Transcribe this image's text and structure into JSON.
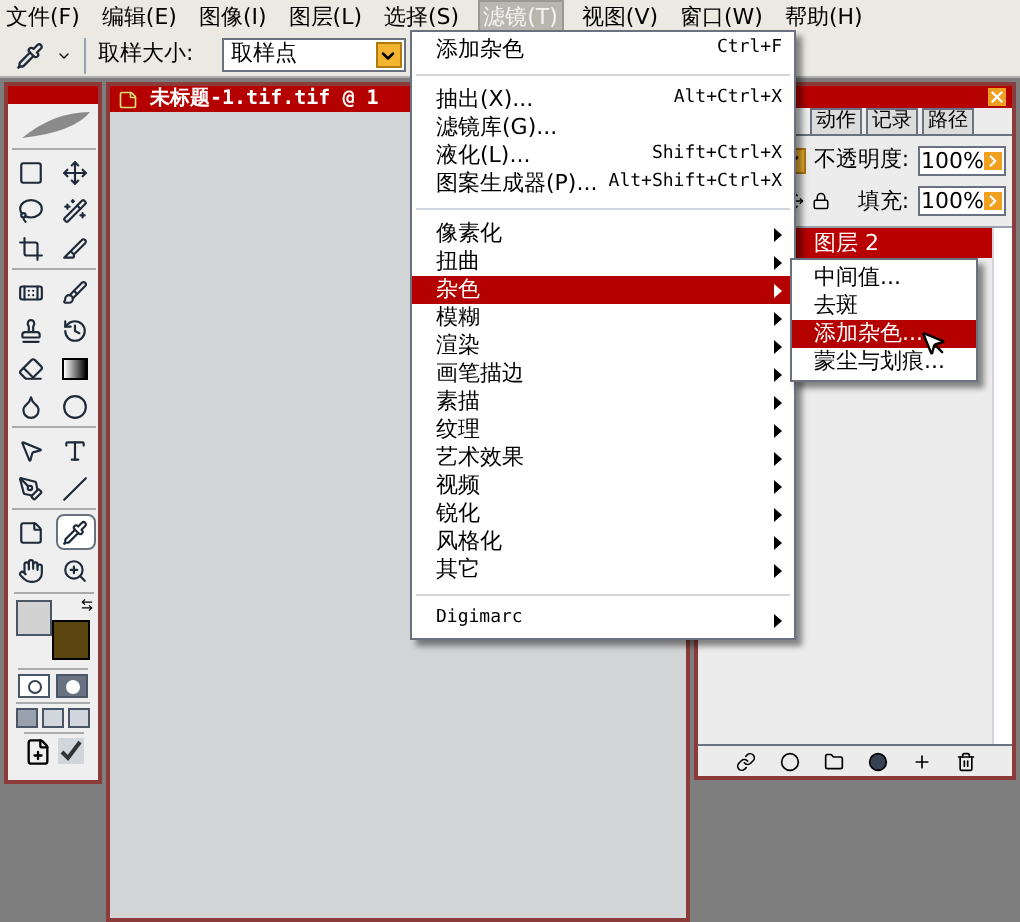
{
  "menu_bar": [
    {
      "label": "文件(F)",
      "selected": false
    },
    {
      "label": "编辑(E)",
      "selected": false
    },
    {
      "label": "图像(I)",
      "selected": false
    },
    {
      "label": "图层(L)",
      "selected": false
    },
    {
      "label": "选择(S)",
      "selected": false
    },
    {
      "label": "滤镜(T)",
      "selected": true
    },
    {
      "label": "视图(V)",
      "selected": false
    },
    {
      "label": "窗口(W)",
      "selected": false
    },
    {
      "label": "帮助(H)",
      "selected": false
    }
  ],
  "options_bar": {
    "sample_size_label": "取样大小:",
    "sample_size_value": "取样点"
  },
  "toolbox": {
    "tools": [
      {
        "kind": "marquee",
        "selected": false
      },
      {
        "kind": "move",
        "selected": false
      },
      {
        "kind": "lasso",
        "selected": false
      },
      {
        "kind": "wand",
        "selected": false
      },
      {
        "kind": "crop",
        "selected": false
      },
      {
        "kind": "slice",
        "selected": false
      },
      {
        "kind": "heal",
        "selected": false
      },
      {
        "kind": "brush",
        "selected": false
      },
      {
        "kind": "stamp",
        "selected": false
      },
      {
        "kind": "history",
        "selected": false
      },
      {
        "kind": "eraser",
        "selected": false
      },
      {
        "kind": "gradient",
        "selected": false
      },
      {
        "kind": "blur",
        "selected": false
      },
      {
        "kind": "burn",
        "selected": false
      },
      {
        "kind": "path",
        "selected": false
      },
      {
        "kind": "type",
        "selected": false
      },
      {
        "kind": "pen",
        "selected": false
      },
      {
        "kind": "line",
        "selected": false
      },
      {
        "kind": "notes",
        "selected": false
      },
      {
        "kind": "eyedropper",
        "selected": true
      },
      {
        "kind": "hand",
        "selected": false
      },
      {
        "kind": "zoom",
        "selected": false
      }
    ],
    "color_swatches": [
      {
        "color": "#d2d2d2"
      },
      {
        "color": "#5a4510"
      }
    ]
  },
  "document": {
    "title": "未标题-1.tif.tif @ 1"
  },
  "filter_menu": [
    {
      "kind": "item",
      "label": "添加杂色",
      "shortcut": "Ctrl+F"
    },
    {
      "kind": "separator"
    },
    {
      "kind": "item",
      "label": "抽出(X)...",
      "shortcut": "Alt+Ctrl+X"
    },
    {
      "kind": "item",
      "label": "滤镜库(G)..."
    },
    {
      "kind": "item",
      "label": "液化(L)...",
      "shortcut": "Shift+Ctrl+X"
    },
    {
      "kind": "item",
      "label": "图案生成器(P)...",
      "shortcut": "Alt+Shift+Ctrl+X"
    },
    {
      "kind": "separator"
    },
    {
      "kind": "submenu",
      "label": "像素化",
      "selected": false
    },
    {
      "kind": "submenu",
      "label": "扭曲",
      "selected": false
    },
    {
      "kind": "submenu",
      "label": "杂色",
      "selected": true
    },
    {
      "kind": "submenu",
      "label": "模糊",
      "selected": false
    },
    {
      "kind": "submenu",
      "label": "渲染",
      "selected": false
    },
    {
      "kind": "submenu",
      "label": "画笔描边",
      "selected": false
    },
    {
      "kind": "submenu",
      "label": "素描",
      "selected": false
    },
    {
      "kind": "submenu",
      "label": "纹理",
      "selected": false
    },
    {
      "kind": "submenu",
      "label": "艺术效果",
      "selected": false
    },
    {
      "kind": "submenu",
      "label": "视频",
      "selected": false
    },
    {
      "kind": "submenu",
      "label": "锐化",
      "selected": false
    },
    {
      "kind": "submenu",
      "label": "风格化",
      "selected": false
    },
    {
      "kind": "submenu",
      "label": "其它",
      "selected": false
    },
    {
      "kind": "separator"
    },
    {
      "kind": "submenu",
      "label": "Digimarc",
      "selected": false
    }
  ],
  "noise_submenu": [
    {
      "label": "中间值...",
      "selected": false
    },
    {
      "label": "去斑",
      "selected": false
    },
    {
      "label": "添加杂色...",
      "selected": true
    },
    {
      "label": "蒙尘与划痕...",
      "selected": false
    }
  ],
  "layers_panel": {
    "tabs": [
      {
        "label": "动作"
      },
      {
        "label": "记录"
      },
      {
        "label": "路径"
      }
    ],
    "opacity_label": "不透明度:",
    "opacity_value": "100%",
    "fill_label": "填充:",
    "fill_value": "100%",
    "layers": [
      {
        "name": "图层 2",
        "selected": true
      }
    ]
  }
}
